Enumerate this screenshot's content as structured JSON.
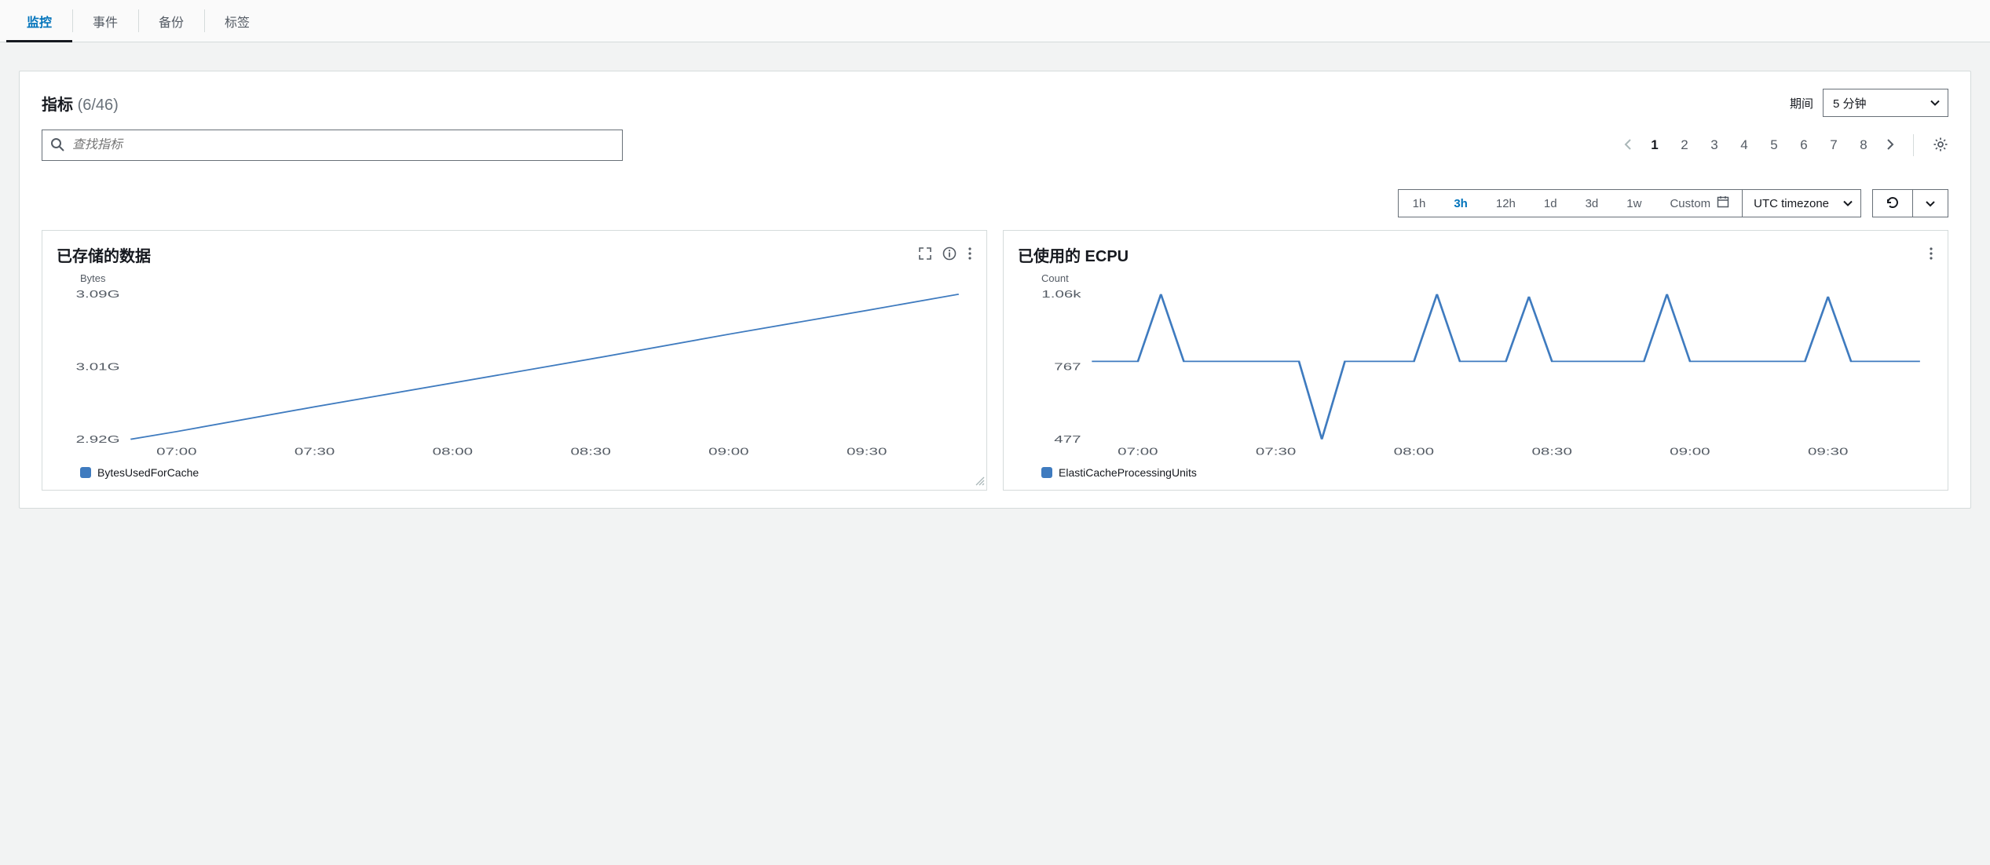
{
  "tabs": [
    {
      "label": "监控",
      "active": true
    },
    {
      "label": "事件",
      "active": false
    },
    {
      "label": "备份",
      "active": false
    },
    {
      "label": "标签",
      "active": false
    }
  ],
  "panel": {
    "title": "指标",
    "count": "(6/46)",
    "period_label": "期间",
    "period_value": "5 分钟",
    "search_placeholder": "查找指标"
  },
  "pager": {
    "pages": [
      "1",
      "2",
      "3",
      "4",
      "5",
      "6",
      "7",
      "8"
    ],
    "current": "1"
  },
  "range_toolbar": {
    "options": [
      "1h",
      "3h",
      "12h",
      "1d",
      "3d",
      "1w"
    ],
    "active": "3h",
    "custom_label": "Custom",
    "timezone": "UTC timezone"
  },
  "charts": [
    {
      "title": "已存储的数据",
      "show_extra_icons": true,
      "ylabel": "Bytes",
      "legend": "BytesUsedForCache"
    },
    {
      "title": "已使用的 ECPU",
      "show_extra_icons": false,
      "ylabel": "Count",
      "legend": "ElastiCacheProcessingUnits"
    }
  ],
  "chart_data": [
    {
      "type": "line",
      "title": "已存储的数据",
      "ylabel": "Bytes",
      "xlabel": "",
      "x_ticks": [
        "07:00",
        "07:30",
        "08:00",
        "08:30",
        "09:00",
        "09:30"
      ],
      "y_ticks": [
        "2.92G",
        "3.01G",
        "3.09G"
      ],
      "ylim": [
        2.92,
        3.09
      ],
      "series": [
        {
          "name": "BytesUsedForCache",
          "x": [
            "06:50",
            "07:00",
            "07:30",
            "08:00",
            "08:30",
            "09:00",
            "09:30",
            "09:50"
          ],
          "y": [
            2.92,
            2.929,
            2.958,
            2.986,
            3.014,
            3.043,
            3.071,
            3.09
          ]
        }
      ]
    },
    {
      "type": "line",
      "title": "已使用的 ECPU",
      "ylabel": "Count",
      "xlabel": "",
      "x_ticks": [
        "07:00",
        "07:30",
        "08:00",
        "08:30",
        "09:00",
        "09:30"
      ],
      "y_ticks": [
        "477",
        "767",
        "1.06k"
      ],
      "ylim": [
        477,
        1060
      ],
      "series": [
        {
          "name": "ElastiCacheProcessingUnits",
          "x": [
            "06:50",
            "06:55",
            "07:00",
            "07:05",
            "07:10",
            "07:15",
            "07:20",
            "07:25",
            "07:30",
            "07:35",
            "07:40",
            "07:45",
            "07:50",
            "07:55",
            "08:00",
            "08:05",
            "08:10",
            "08:15",
            "08:20",
            "08:25",
            "08:30",
            "08:35",
            "08:40",
            "08:45",
            "08:50",
            "08:55",
            "09:00",
            "09:05",
            "09:10",
            "09:15",
            "09:20",
            "09:25",
            "09:30",
            "09:35",
            "09:40",
            "09:45",
            "09:50"
          ],
          "y": [
            790,
            790,
            790,
            1060,
            790,
            790,
            790,
            790,
            790,
            790,
            477,
            790,
            790,
            790,
            790,
            1060,
            790,
            790,
            790,
            1050,
            790,
            790,
            790,
            790,
            790,
            1060,
            790,
            790,
            790,
            790,
            790,
            790,
            1050,
            790,
            790,
            790,
            790
          ]
        }
      ]
    }
  ]
}
